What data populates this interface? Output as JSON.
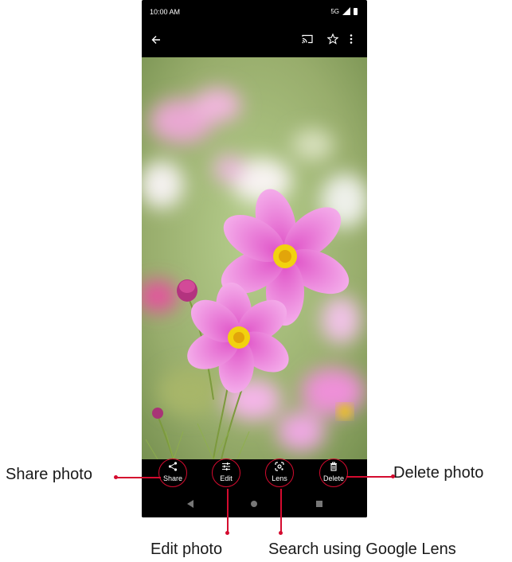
{
  "status_bar": {
    "time": "10:00 AM",
    "network": "5G"
  },
  "app_bar": {
    "back_icon": "arrow-left-icon",
    "cast_icon": "cast-icon",
    "favorite_icon": "star-outline-icon",
    "more_icon": "vertical-dots-icon"
  },
  "actions": {
    "share_label": "Share",
    "edit_label": "Edit",
    "lens_label": "Lens",
    "delete_label": "Delete"
  },
  "callouts": {
    "share": "Share photo",
    "edit": "Edit photo",
    "lens": "Search using Google Lens",
    "delete": "Delete photo"
  },
  "colors": {
    "accent": "#d40b2f",
    "bar_background": "#000000",
    "icon": "#ffffff"
  }
}
